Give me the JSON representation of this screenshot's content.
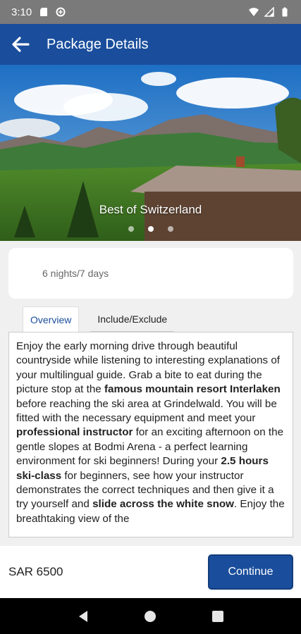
{
  "status_bar": {
    "time": "3:10",
    "left_icons": [
      "sd-card-icon",
      "data-saver-icon"
    ],
    "right_icons": [
      "wifi-icon",
      "signal-icon",
      "battery-icon"
    ]
  },
  "app_bar": {
    "title": "Package Details",
    "back_icon": "arrow-left-icon"
  },
  "hero": {
    "caption": "Best of Switzerland",
    "slide_count": 3,
    "active_slide": 2
  },
  "package": {
    "duration": "6 nights/7 days"
  },
  "tabs": [
    {
      "label": "Overview",
      "active": true
    },
    {
      "label": "Include/Exclude",
      "active": false
    }
  ],
  "overview": [
    {
      "text": "Enjoy the early morning drive through beautiful countryside while listening to interesting explanations of your multilingual guide. Grab a bite to eat during the picture stop at the ",
      "bold": false
    },
    {
      "text": "famous mountain resort Interlaken",
      "bold": true
    },
    {
      "text": " before reaching the ski area at Grindelwald. You will be fitted with the necessary equipment and meet your ",
      "bold": false
    },
    {
      "text": "professional instructor",
      "bold": true
    },
    {
      "text": " for an exciting afternoon on the gentle slopes at Bodmi Arena - a perfect learning environment for ski beginners! During your ",
      "bold": false
    },
    {
      "text": "2.5 hours ski-class",
      "bold": true
    },
    {
      "text": " for beginners, see how your instructor demonstrates the correct techniques and then give it a try yourself and ",
      "bold": false
    },
    {
      "text": "slide across the white snow",
      "bold": true
    },
    {
      "text": ". Enjoy the breathtaking view of the",
      "bold": false
    }
  ],
  "footer": {
    "price": "SAR 6500",
    "continue_label": "Continue"
  },
  "nav_bar": {
    "icons": [
      "back-triangle-icon",
      "home-circle-icon",
      "recents-square-icon"
    ]
  },
  "colors": {
    "primary": "#1a4e9c",
    "status_bar": "#7a7a7a",
    "background": "#f0f0f0"
  }
}
